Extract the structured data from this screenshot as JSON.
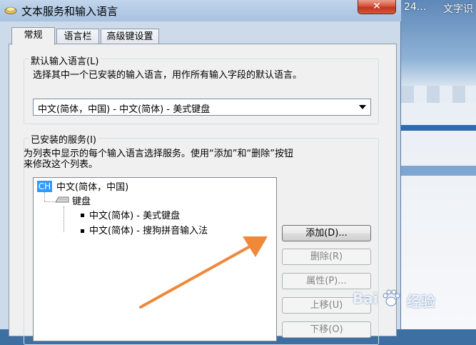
{
  "background": {
    "top_text_left": "24...",
    "top_text_right": "文字识"
  },
  "window": {
    "title": "文本服务和输入语言",
    "close_label": "✕"
  },
  "tabs": [
    {
      "label": "常规",
      "active": true
    },
    {
      "label": "语言栏",
      "active": false
    },
    {
      "label": "高级键设置",
      "active": false
    }
  ],
  "default_language": {
    "group_label": "默认输入语言(L)",
    "description": "选择其中一个已安装的输入语言，用作所有输入字段的默认语言。",
    "selected": "中文(简体，中国) - 中文(简体) - 美式键盘"
  },
  "installed_services": {
    "group_label": "已安装的服务(I)",
    "description_line1": "为列表中显示的每个输入语言选择服务。使用“添加”和“删除”按钮",
    "description_line2": "来修改这个列表。",
    "tree": {
      "language_badge": "CH",
      "language": "中文(简体，中国)",
      "category": "键盘",
      "items": [
        "中文(简体) - 美式键盘",
        "中文(简体) - 搜狗拼音输入法"
      ]
    }
  },
  "buttons": {
    "add": "添加(D)...",
    "remove": "删除(R)",
    "properties": "属性(P)...",
    "move_up": "上移(U)",
    "move_down": "下移(O)"
  },
  "watermark": {
    "text": "Bai",
    "text2": "经验"
  },
  "colors": {
    "accent_arrow": "#f0883a",
    "selection": "#3399ff"
  }
}
